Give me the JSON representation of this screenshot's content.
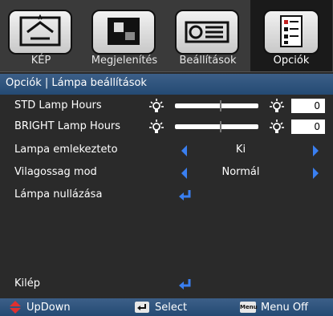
{
  "tabs": [
    {
      "label": "KÉP",
      "icon": "picture-icon"
    },
    {
      "label": "Megjelenítés",
      "icon": "display-icon"
    },
    {
      "label": "Beállítások",
      "icon": "projector-icon"
    },
    {
      "label": "Opciók",
      "icon": "options-icon",
      "active": true
    }
  ],
  "breadcrumb": "Opciók | Lámpa beállítások",
  "rows": {
    "std_lamp": {
      "label": "STD Lamp Hours",
      "value": "0",
      "level": 0.55
    },
    "bright_lamp": {
      "label": "BRIGHT Lamp Hours",
      "value": "0",
      "level": 0.55
    },
    "reminder": {
      "label": "Lampa emlekezteto",
      "value": "Ki"
    },
    "brightness_mode": {
      "label": "Vilagossag mod",
      "value": "Normál"
    },
    "lamp_reset": {
      "label": "Lámpa nullázása"
    },
    "exit": {
      "label": "Kilép"
    }
  },
  "footer": {
    "updown": "UpDown",
    "select": "Select",
    "menu_key": "Menu",
    "menu_off": "Menu Off"
  },
  "colors": {
    "accent_blue": "#3a7ff0",
    "bar_blue": "#2f547f",
    "updown_red": "#e03030"
  }
}
